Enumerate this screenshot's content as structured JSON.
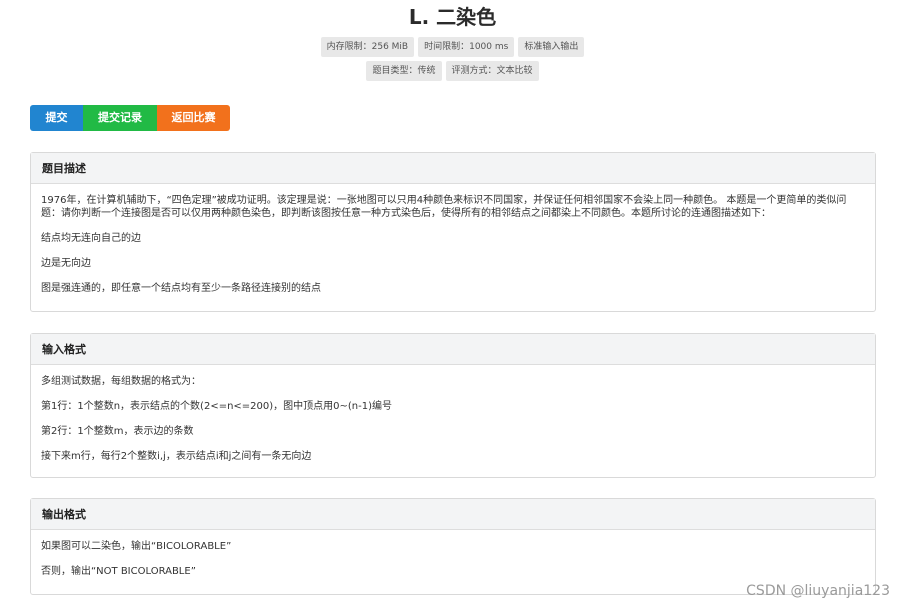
{
  "problem": {
    "title": "L. 二染色",
    "tags_row1": [
      "内存限制：256 MiB",
      "时间限制：1000 ms",
      "标准输入输出"
    ],
    "tags_row2": [
      "题目类型：传统",
      "评测方式：文本比较"
    ]
  },
  "actions": {
    "submit_label": "提交",
    "records_label": "提交记录",
    "back_label": "返回比赛"
  },
  "description": {
    "heading": "题目描述",
    "paragraphs": [
      "1976年，在计算机辅助下，“四色定理”被成功证明。该定理是说：一张地图可以只用4种颜色来标识不同国家，并保证任何相邻国家不会染上同一种颜色。 本题是一个更简单的类似问题：请你判断一个连接图是否可以仅用两种颜色染色，即判断该图按任意一种方式染色后，使得所有的相邻结点之间都染上不同颜色。本题所讨论的连通图描述如下：",
      "结点均无连向自己的边",
      "边是无向边",
      "图是强连通的，即任意一个结点均有至少一条路径连接别的结点"
    ]
  },
  "input_format": {
    "heading": "输入格式",
    "paragraphs": [
      "多组测试数据，每组数据的格式为：",
      "第1行：1个整数n，表示结点的个数(2<=n<=200)，图中顶点用0~(n-1)编号",
      "第2行：1个整数m，表示边的条数",
      "接下来m行，每行2个整数i,j，表示结点i和j之间有一条无向边"
    ]
  },
  "output_format": {
    "heading": "输出格式",
    "paragraphs": [
      "如果图可以二染色，输出“BICOLORABLE”",
      "否则，输出“NOT BICOLORABLE”"
    ]
  },
  "watermark": "CSDN @liuyanjia123"
}
